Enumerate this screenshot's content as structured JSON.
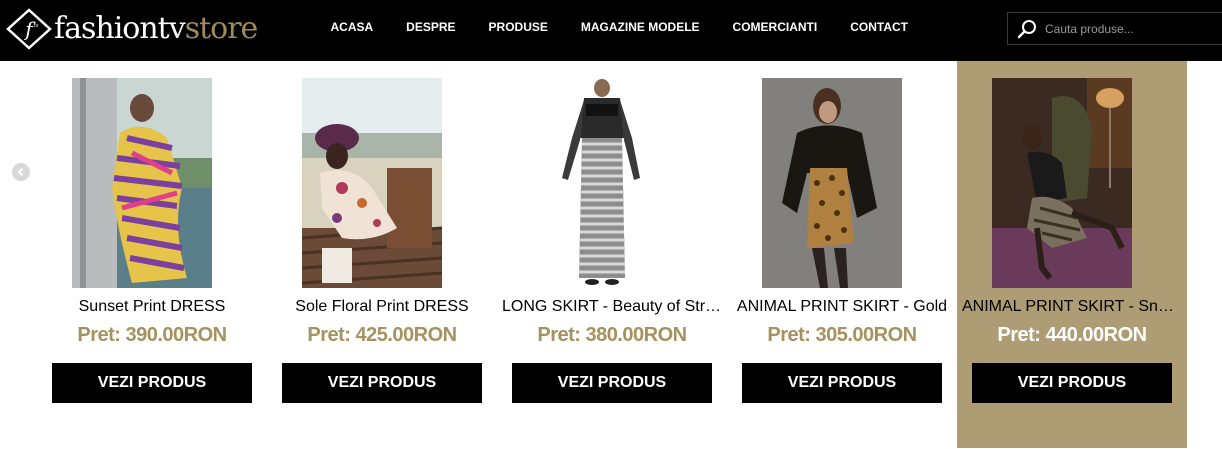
{
  "header": {
    "logo_text_white": "fashiontv",
    "logo_text_gold": "store",
    "nav": [
      {
        "label": "ACASA"
      },
      {
        "label": "DESPRE"
      },
      {
        "label": "PRODUSE"
      },
      {
        "label": "MAGAZINE MODELE"
      },
      {
        "label": "COMERCIANTI"
      },
      {
        "label": "CONTACT"
      }
    ],
    "search": {
      "placeholder": "Cauta produse..."
    }
  },
  "colors": {
    "gold": "#a6925e",
    "highlight_bg": "#ad9c74",
    "header_bg": "#000000"
  },
  "products": [
    {
      "name": "Sunset Print DRESS",
      "price": "Pret: 390.00RON",
      "button": "VEZI PRODUS"
    },
    {
      "name": "Sole Floral Print DRESS",
      "price": "Pret: 425.00RON",
      "button": "VEZI PRODUS"
    },
    {
      "name": "LONG SKIRT - Beauty of Stripes",
      "price": "Pret: 380.00RON",
      "button": "VEZI PRODUS"
    },
    {
      "name": "ANIMAL PRINT SKIRT - Gold",
      "price": "Pret: 305.00RON",
      "button": "VEZI PRODUS"
    },
    {
      "name": "ANIMAL PRINT SKIRT - Snake",
      "price": "Pret: 440.00RON",
      "button": "VEZI PRODUS"
    }
  ]
}
